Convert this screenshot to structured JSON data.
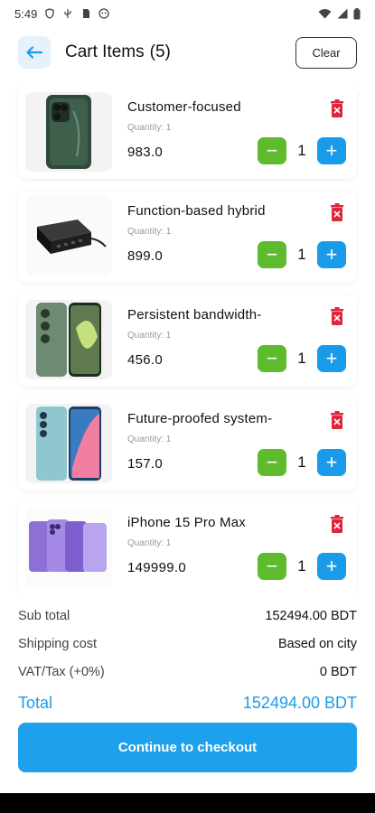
{
  "status": {
    "time": "5:49",
    "icons_left": [
      "shield-icon",
      "usb-icon",
      "sd-card-icon",
      "robot-icon"
    ],
    "icons_right": [
      "wifi-icon",
      "signal-icon",
      "battery-icon"
    ]
  },
  "header": {
    "title": "Cart Items",
    "count": "(5)",
    "clear_label": "Clear"
  },
  "colors": {
    "accent": "#1a9bea",
    "minus": "#5dbb2d",
    "delete": "#e0243a"
  },
  "items": [
    {
      "name": "Customer-focused",
      "qty_label": "Quantity: 1",
      "price": "983.0",
      "count": "1",
      "minus": "−",
      "plus": "+",
      "image": "green-iphone"
    },
    {
      "name": "Function-based hybrid",
      "qty_label": "Quantity: 1",
      "price": "899.0",
      "count": "1",
      "minus": "−",
      "plus": "+",
      "image": "usb-charger"
    },
    {
      "name": "Persistent bandwidth-",
      "qty_label": "Quantity: 1",
      "price": "456.0",
      "count": "1",
      "minus": "−",
      "plus": "+",
      "image": "green-galaxy"
    },
    {
      "name": "Future-proofed system-",
      "qty_label": "Quantity: 1",
      "price": "157.0",
      "count": "1",
      "minus": "−",
      "plus": "+",
      "image": "galaxy-f13"
    },
    {
      "name": "iPhone 15 Pro Max",
      "qty_label": "Quantity: 1",
      "price": "149999.0",
      "count": "1",
      "minus": "−",
      "plus": "+",
      "image": "purple-iphones"
    }
  ],
  "summary": {
    "subtotal_label": "Sub total",
    "subtotal_value": "152494.00 BDT",
    "shipping_label": "Shipping cost",
    "shipping_value": "Based on city",
    "vat_label": "VAT/Tax (+0%)",
    "vat_value": "0 BDT",
    "total_label": "Total",
    "total_value": "152494.00 BDT"
  },
  "checkout_label": "Continue to checkout"
}
